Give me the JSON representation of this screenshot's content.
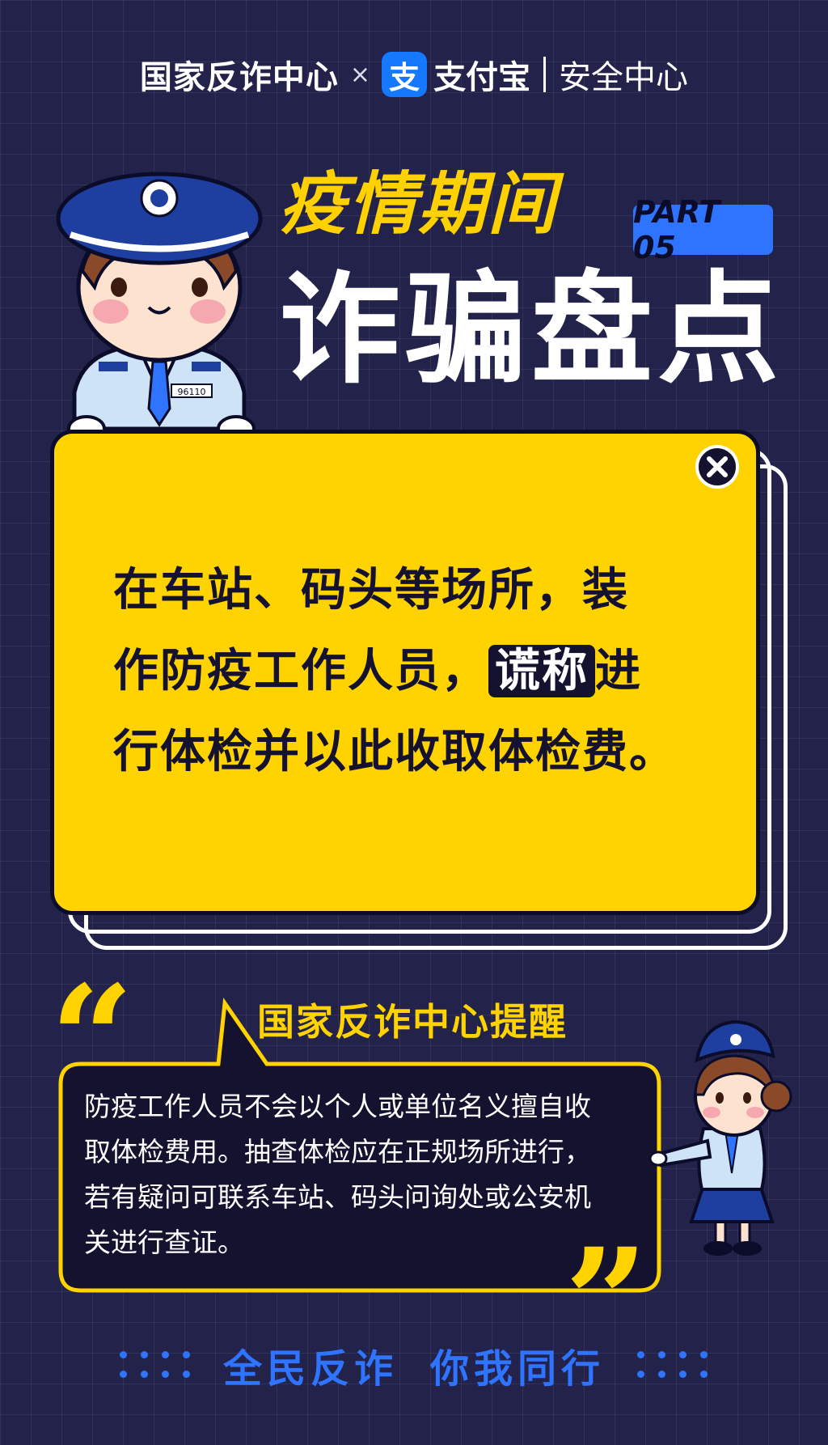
{
  "header": {
    "org": "国家反诈中心",
    "times": "×",
    "alipay_logo_char": "支",
    "alipay": "支付宝",
    "security": "安全中心"
  },
  "title": {
    "subtitle": "疫情期间",
    "part": "PART 05",
    "main": "诈骗盘点"
  },
  "officer_badge": "96110",
  "card": {
    "line1": "在车站、码头等场所，装",
    "line2_pre": "作防疫工作人员，",
    "line2_highlight": "谎称",
    "line2_post": "进",
    "line3": "行体检并以此收取体检费。"
  },
  "reminder": {
    "quote_open": "“",
    "quote_close": "”",
    "title": "国家反诈中心提醒",
    "body": "防疫工作人员不会以个人或单位名义擅自收取体检费用。抽查体检应在正规场所进行，若有疑问可联系车站、码头问询处或公安机关进行查证。"
  },
  "footer": {
    "slogan_left": "全民反诈",
    "slogan_right": "你我同行"
  },
  "colors": {
    "background": "#22224a",
    "accent_yellow": "#ffd300",
    "accent_blue": "#2f74ff",
    "alipay_blue": "#1677ff",
    "dark": "#14122e"
  },
  "icons": [
    "close-icon",
    "alipay-logo-icon",
    "police-officer-illustration",
    "female-officer-illustration"
  ]
}
